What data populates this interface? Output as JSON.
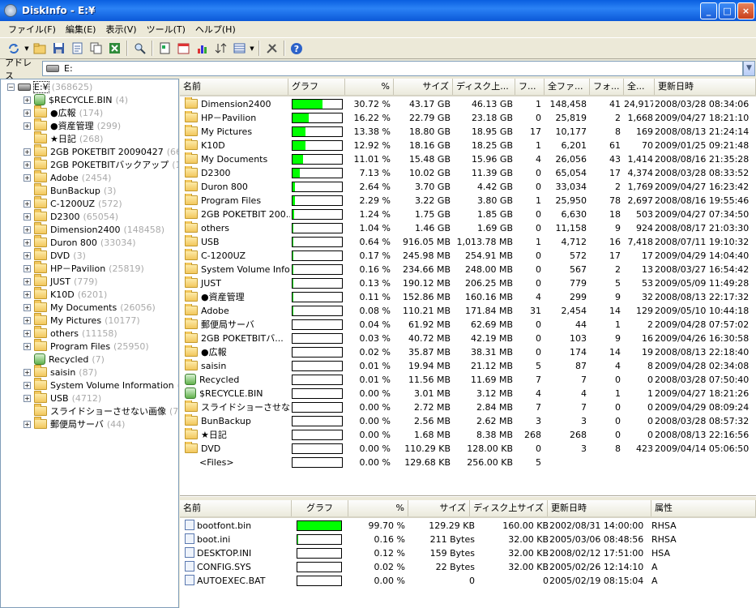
{
  "window": {
    "title": "DiskInfo - E:¥",
    "buttons": [
      "_",
      "□",
      "×"
    ]
  },
  "menu": [
    "ファイル(F)",
    "編集(E)",
    "表示(V)",
    "ツール(T)",
    "ヘルプ(H)"
  ],
  "toolbar": {
    "icons": [
      "refresh-icon",
      "open-folder-icon",
      "save-icon",
      "export-icon",
      "copy-icon",
      "excel-icon",
      "find-icon",
      "properties-icon",
      "calendar-icon",
      "chart-icon",
      "sort-icon",
      "view-icon",
      "tools-icon",
      "help-icon"
    ]
  },
  "address": {
    "label": "アドレス",
    "value": "E:"
  },
  "tree": {
    "root": {
      "name": "E:¥",
      "count": "(368625)"
    },
    "items": [
      {
        "name": "$RECYCLE.BIN",
        "count": "(4)",
        "icon": "recycle"
      },
      {
        "name": "●広報",
        "count": "(174)",
        "icon": "folder"
      },
      {
        "name": "●資産管理",
        "count": "(299)",
        "icon": "folder"
      },
      {
        "name": "★日記",
        "count": "(268)",
        "icon": "folder",
        "leaf": true
      },
      {
        "name": "2GB POKETBIT 20090427",
        "count": "(66",
        "icon": "folder"
      },
      {
        "name": "2GB POKETBITバックアップ",
        "count": "(1",
        "icon": "folder"
      },
      {
        "name": "Adobe",
        "count": "(2454)",
        "icon": "folder"
      },
      {
        "name": "BunBackup",
        "count": "(3)",
        "icon": "folder",
        "leaf": true
      },
      {
        "name": "C-1200UZ",
        "count": "(572)",
        "icon": "folder"
      },
      {
        "name": "D2300",
        "count": "(65054)",
        "icon": "folder"
      },
      {
        "name": "Dimension2400",
        "count": "(148458)",
        "icon": "folder"
      },
      {
        "name": "Duron 800",
        "count": "(33034)",
        "icon": "folder"
      },
      {
        "name": "DVD",
        "count": "(3)",
        "icon": "folder"
      },
      {
        "name": "HP－Pavilion",
        "count": "(25819)",
        "icon": "folder"
      },
      {
        "name": "JUST",
        "count": "(779)",
        "icon": "folder"
      },
      {
        "name": "K10D",
        "count": "(6201)",
        "icon": "folder"
      },
      {
        "name": "My Documents",
        "count": "(26056)",
        "icon": "folder"
      },
      {
        "name": "My Pictures",
        "count": "(10177)",
        "icon": "folder"
      },
      {
        "name": "others",
        "count": "(11158)",
        "icon": "folder"
      },
      {
        "name": "Program Files",
        "count": "(25950)",
        "icon": "folder"
      },
      {
        "name": "Recycled",
        "count": "(7)",
        "icon": "recycle",
        "leaf": true
      },
      {
        "name": "saisin",
        "count": "(87)",
        "icon": "folder"
      },
      {
        "name": "System Volume Information",
        "count": "(5",
        "icon": "folder"
      },
      {
        "name": "USB",
        "count": "(4712)",
        "icon": "folder"
      },
      {
        "name": "スライドショーさせない画像",
        "count": "(7)",
        "icon": "folder",
        "leaf": true
      },
      {
        "name": "郵便局サーバ",
        "count": "(44)",
        "icon": "folder"
      }
    ]
  },
  "folders": {
    "headers": [
      "名前",
      "グラフ",
      "%",
      "サイズ",
      "ディスク上...",
      "フ...",
      "全ファ...",
      "フォ...",
      "全...",
      "更新日時"
    ],
    "rows": [
      {
        "name": "Dimension2400",
        "pct": "30.72 %",
        "p": 30.72,
        "size": "43.17 GB",
        "disk": "46.13 GB",
        "f": "1",
        "af": "148,458",
        "fo": "41",
        "al": "24,917",
        "date": "2008/03/28 08:34:06",
        "icon": "folder"
      },
      {
        "name": "HP－Pavilion",
        "pct": "16.22 %",
        "p": 16.22,
        "size": "22.79 GB",
        "disk": "23.18 GB",
        "f": "0",
        "af": "25,819",
        "fo": "2",
        "al": "1,668",
        "date": "2009/04/27 18:21:10",
        "icon": "folder"
      },
      {
        "name": "My Pictures",
        "pct": "13.38 %",
        "p": 13.38,
        "size": "18.80 GB",
        "disk": "18.95 GB",
        "f": "17",
        "af": "10,177",
        "fo": "8",
        "al": "169",
        "date": "2008/08/13 21:24:14",
        "icon": "folder"
      },
      {
        "name": "K10D",
        "pct": "12.92 %",
        "p": 12.92,
        "size": "18.16 GB",
        "disk": "18.25 GB",
        "f": "1",
        "af": "6,201",
        "fo": "61",
        "al": "70",
        "date": "2009/01/25 09:21:48",
        "icon": "folder"
      },
      {
        "name": "My Documents",
        "pct": "11.01 %",
        "p": 11.01,
        "size": "15.48 GB",
        "disk": "15.96 GB",
        "f": "4",
        "af": "26,056",
        "fo": "43",
        "al": "1,414",
        "date": "2008/08/16 21:35:28",
        "icon": "folder"
      },
      {
        "name": "D2300",
        "pct": "7.13 %",
        "p": 7.13,
        "size": "10.02 GB",
        "disk": "11.39 GB",
        "f": "0",
        "af": "65,054",
        "fo": "17",
        "al": "4,374",
        "date": "2008/03/28 08:33:52",
        "icon": "folder"
      },
      {
        "name": "Duron 800",
        "pct": "2.64 %",
        "p": 2.64,
        "size": "3.70 GB",
        "disk": "4.42 GB",
        "f": "0",
        "af": "33,034",
        "fo": "2",
        "al": "1,769",
        "date": "2009/04/27 16:23:42",
        "icon": "folder"
      },
      {
        "name": "Program Files",
        "pct": "2.29 %",
        "p": 2.29,
        "size": "3.22 GB",
        "disk": "3.80 GB",
        "f": "1",
        "af": "25,950",
        "fo": "78",
        "al": "2,697",
        "date": "2008/08/16 19:55:46",
        "icon": "folder"
      },
      {
        "name": "2GB POKETBIT 200...",
        "pct": "1.24 %",
        "p": 1.24,
        "size": "1.75 GB",
        "disk": "1.85 GB",
        "f": "0",
        "af": "6,630",
        "fo": "18",
        "al": "503",
        "date": "2009/04/27 07:34:50",
        "icon": "folder"
      },
      {
        "name": "others",
        "pct": "1.04 %",
        "p": 1.04,
        "size": "1.46 GB",
        "disk": "1.69 GB",
        "f": "0",
        "af": "11,158",
        "fo": "9",
        "al": "924",
        "date": "2008/08/17 21:03:30",
        "icon": "folder"
      },
      {
        "name": "USB",
        "pct": "0.64 %",
        "p": 0.64,
        "size": "916.05 MB",
        "disk": "1,013.78 MB",
        "f": "1",
        "af": "4,712",
        "fo": "16",
        "al": "7,418",
        "date": "2008/07/11 19:10:32",
        "icon": "folder"
      },
      {
        "name": "C-1200UZ",
        "pct": "0.17 %",
        "p": 0.17,
        "size": "245.98 MB",
        "disk": "254.91 MB",
        "f": "0",
        "af": "572",
        "fo": "17",
        "al": "17",
        "date": "2009/04/29 14:04:40",
        "icon": "folder"
      },
      {
        "name": "System Volume Info...",
        "pct": "0.16 %",
        "p": 0.16,
        "size": "234.66 MB",
        "disk": "248.00 MB",
        "f": "0",
        "af": "567",
        "fo": "2",
        "al": "13",
        "date": "2008/03/27 16:54:42",
        "icon": "folder"
      },
      {
        "name": "JUST",
        "pct": "0.13 %",
        "p": 0.13,
        "size": "190.12 MB",
        "disk": "206.25 MB",
        "f": "0",
        "af": "779",
        "fo": "5",
        "al": "53",
        "date": "2009/05/09 11:49:28",
        "icon": "folder"
      },
      {
        "name": "●資産管理",
        "pct": "0.11 %",
        "p": 0.11,
        "size": "152.86 MB",
        "disk": "160.16 MB",
        "f": "4",
        "af": "299",
        "fo": "9",
        "al": "32",
        "date": "2008/08/13 22:17:32",
        "icon": "folder"
      },
      {
        "name": "Adobe",
        "pct": "0.08 %",
        "p": 0.08,
        "size": "110.21 MB",
        "disk": "171.84 MB",
        "f": "31",
        "af": "2,454",
        "fo": "14",
        "al": "129",
        "date": "2009/05/10 10:44:18",
        "icon": "folder"
      },
      {
        "name": "郵便局サーバ",
        "pct": "0.04 %",
        "p": 0.04,
        "size": "61.92 MB",
        "disk": "62.69 MB",
        "f": "0",
        "af": "44",
        "fo": "1",
        "al": "2",
        "date": "2009/04/28 07:57:02",
        "icon": "folder"
      },
      {
        "name": "2GB POKETBITバ...",
        "pct": "0.03 %",
        "p": 0.03,
        "size": "40.72 MB",
        "disk": "42.19 MB",
        "f": "0",
        "af": "103",
        "fo": "9",
        "al": "16",
        "date": "2009/04/26 16:30:58",
        "icon": "folder"
      },
      {
        "name": "●広報",
        "pct": "0.02 %",
        "p": 0.02,
        "size": "35.87 MB",
        "disk": "38.31 MB",
        "f": "0",
        "af": "174",
        "fo": "14",
        "al": "19",
        "date": "2008/08/13 22:18:40",
        "icon": "folder"
      },
      {
        "name": "saisin",
        "pct": "0.01 %",
        "p": 0.01,
        "size": "19.94 MB",
        "disk": "21.12 MB",
        "f": "5",
        "af": "87",
        "fo": "4",
        "al": "8",
        "date": "2009/04/28 02:34:08",
        "icon": "folder"
      },
      {
        "name": "Recycled",
        "pct": "0.01 %",
        "p": 0.01,
        "size": "11.56 MB",
        "disk": "11.69 MB",
        "f": "7",
        "af": "7",
        "fo": "0",
        "al": "0",
        "date": "2008/03/28 07:50:40",
        "icon": "recycle"
      },
      {
        "name": "$RECYCLE.BIN",
        "pct": "0.00 %",
        "p": 0,
        "size": "3.01 MB",
        "disk": "3.12 MB",
        "f": "4",
        "af": "4",
        "fo": "1",
        "al": "1",
        "date": "2009/04/27 18:21:26",
        "icon": "recycle"
      },
      {
        "name": "スライドショーさせない...",
        "pct": "0.00 %",
        "p": 0,
        "size": "2.72 MB",
        "disk": "2.84 MB",
        "f": "7",
        "af": "7",
        "fo": "0",
        "al": "0",
        "date": "2009/04/29 08:09:24",
        "icon": "folder"
      },
      {
        "name": "BunBackup",
        "pct": "0.00 %",
        "p": 0,
        "size": "2.56 MB",
        "disk": "2.62 MB",
        "f": "3",
        "af": "3",
        "fo": "0",
        "al": "0",
        "date": "2008/03/28 08:57:32",
        "icon": "folder"
      },
      {
        "name": "★日記",
        "pct": "0.00 %",
        "p": 0,
        "size": "1.68 MB",
        "disk": "8.38 MB",
        "f": "268",
        "af": "268",
        "fo": "0",
        "al": "0",
        "date": "2008/08/13 22:16:56",
        "icon": "folder"
      },
      {
        "name": "DVD",
        "pct": "0.00 %",
        "p": 0,
        "size": "110.29 KB",
        "disk": "128.00 KB",
        "f": "0",
        "af": "3",
        "fo": "8",
        "al": "423",
        "date": "2009/04/14 05:06:50",
        "icon": "folder"
      },
      {
        "name": "<Files>",
        "pct": "0.00 %",
        "p": 0,
        "size": "129.68 KB",
        "disk": "256.00 KB",
        "f": "5",
        "af": "",
        "fo": "",
        "al": "",
        "date": "",
        "icon": "none"
      }
    ]
  },
  "files": {
    "headers": [
      "名前",
      "グラフ",
      "%",
      "サイズ",
      "ディスク上サイズ",
      "更新日時",
      "属性"
    ],
    "rows": [
      {
        "name": "bootfont.bin",
        "pct": "99.70 %",
        "p": 99.7,
        "size": "129.29 KB",
        "disk": "160.00 KB",
        "date": "2002/08/31 14:00:00",
        "attr": "RHSA"
      },
      {
        "name": "boot.ini",
        "pct": "0.16 %",
        "p": 0.16,
        "size": "211 Bytes",
        "disk": "32.00 KB",
        "date": "2005/03/06 08:48:56",
        "attr": "RHSA"
      },
      {
        "name": "DESKTOP.INI",
        "pct": "0.12 %",
        "p": 0.12,
        "size": "159 Bytes",
        "disk": "32.00 KB",
        "date": "2008/02/12 17:51:00",
        "attr": "HSA"
      },
      {
        "name": "CONFIG.SYS",
        "pct": "0.02 %",
        "p": 0.02,
        "size": "22 Bytes",
        "disk": "32.00 KB",
        "date": "2005/02/26 12:14:10",
        "attr": "A"
      },
      {
        "name": "AUTOEXEC.BAT",
        "pct": "0.00 %",
        "p": 0,
        "size": "0",
        "disk": "0",
        "date": "2005/02/19 08:15:04",
        "attr": "A"
      }
    ]
  }
}
